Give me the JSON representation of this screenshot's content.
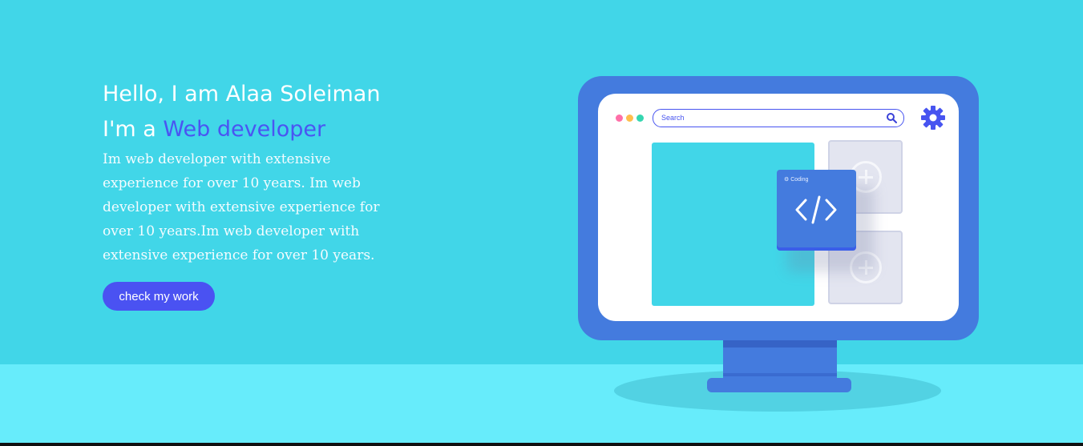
{
  "hero": {
    "greeting": "Hello, I am Alaa Soleiman",
    "role_prefix": "I'm a ",
    "role_highlight": "Web developer",
    "description": "Im web developer with extensive experience for over 10 years. Im web developer with extensive experience for over 10 years.Im web developer with extensive experience for over 10 years.",
    "cta_label": "check my work"
  },
  "illustration": {
    "search_placeholder": "Search",
    "code_card_label": "⚙ Coding",
    "icons": [
      "search-icon",
      "gear-icon",
      "code-icon",
      "plus-icon"
    ],
    "window_dots": [
      "#ff6fa8",
      "#ffbe4d",
      "#35d6b0"
    ]
  },
  "colors": {
    "background": "#41d6e8",
    "floor": "#67ecfb",
    "accent": "#4a52f2",
    "monitor": "#447bde"
  }
}
